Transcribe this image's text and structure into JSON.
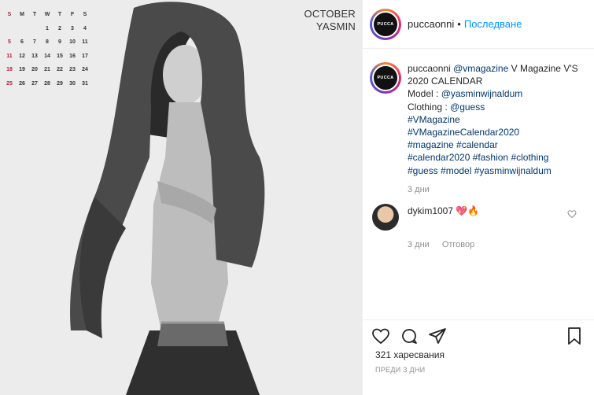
{
  "photo": {
    "month": "OCTOBER",
    "name": "YASMIN",
    "calendar": {
      "weekdays": [
        "S",
        "M",
        "T",
        "W",
        "T",
        "F",
        "S"
      ],
      "weeks": [
        [
          "",
          "",
          "",
          "1",
          "2",
          "3",
          "4"
        ],
        [
          "5",
          "6",
          "7",
          "8",
          "9",
          "10",
          "11"
        ],
        [
          "11",
          "12",
          "13",
          "14",
          "15",
          "16",
          "17"
        ],
        [
          "18",
          "19",
          "20",
          "21",
          "22",
          "23",
          "24"
        ],
        [
          "25",
          "26",
          "27",
          "28",
          "29",
          "30",
          "31"
        ]
      ]
    }
  },
  "header": {
    "avatar_text": "PUCCA",
    "username": "puccaonni",
    "separator": "•",
    "follow_label": "Последване"
  },
  "caption": {
    "username": "puccaonni",
    "lines": [
      {
        "text": "@vmagazine",
        "tag": true
      },
      {
        "text": " V Magazine V'S 2020 CALENDAR",
        "tag": false
      }
    ],
    "model_label": "Model : ",
    "model_tag": "@yasminwijnaldum",
    "clothing_label": "Clothing : ",
    "clothing_tag": "@guess",
    "hashtags_1": "#VMagazine",
    "hashtags_2": "#VMagazineCalendar2020",
    "hashtags_3": "#magazine #calendar",
    "hashtags_4": "#calendar2020 #fashion #clothing",
    "hashtags_5": "#guess #model #yasminwijnaldum",
    "time": "3 дни"
  },
  "comment": {
    "username": "dykim1007",
    "emoji": "💖🔥",
    "time": "3 дни",
    "reply_label": "Отговор"
  },
  "footer": {
    "likes": "321 харесвания",
    "timestamp": "ПРЕДИ 3 ДНИ"
  },
  "colors": {
    "accent": "#0095f6",
    "tag": "#00376b",
    "muted": "#8e8e8e",
    "text": "#262626"
  }
}
